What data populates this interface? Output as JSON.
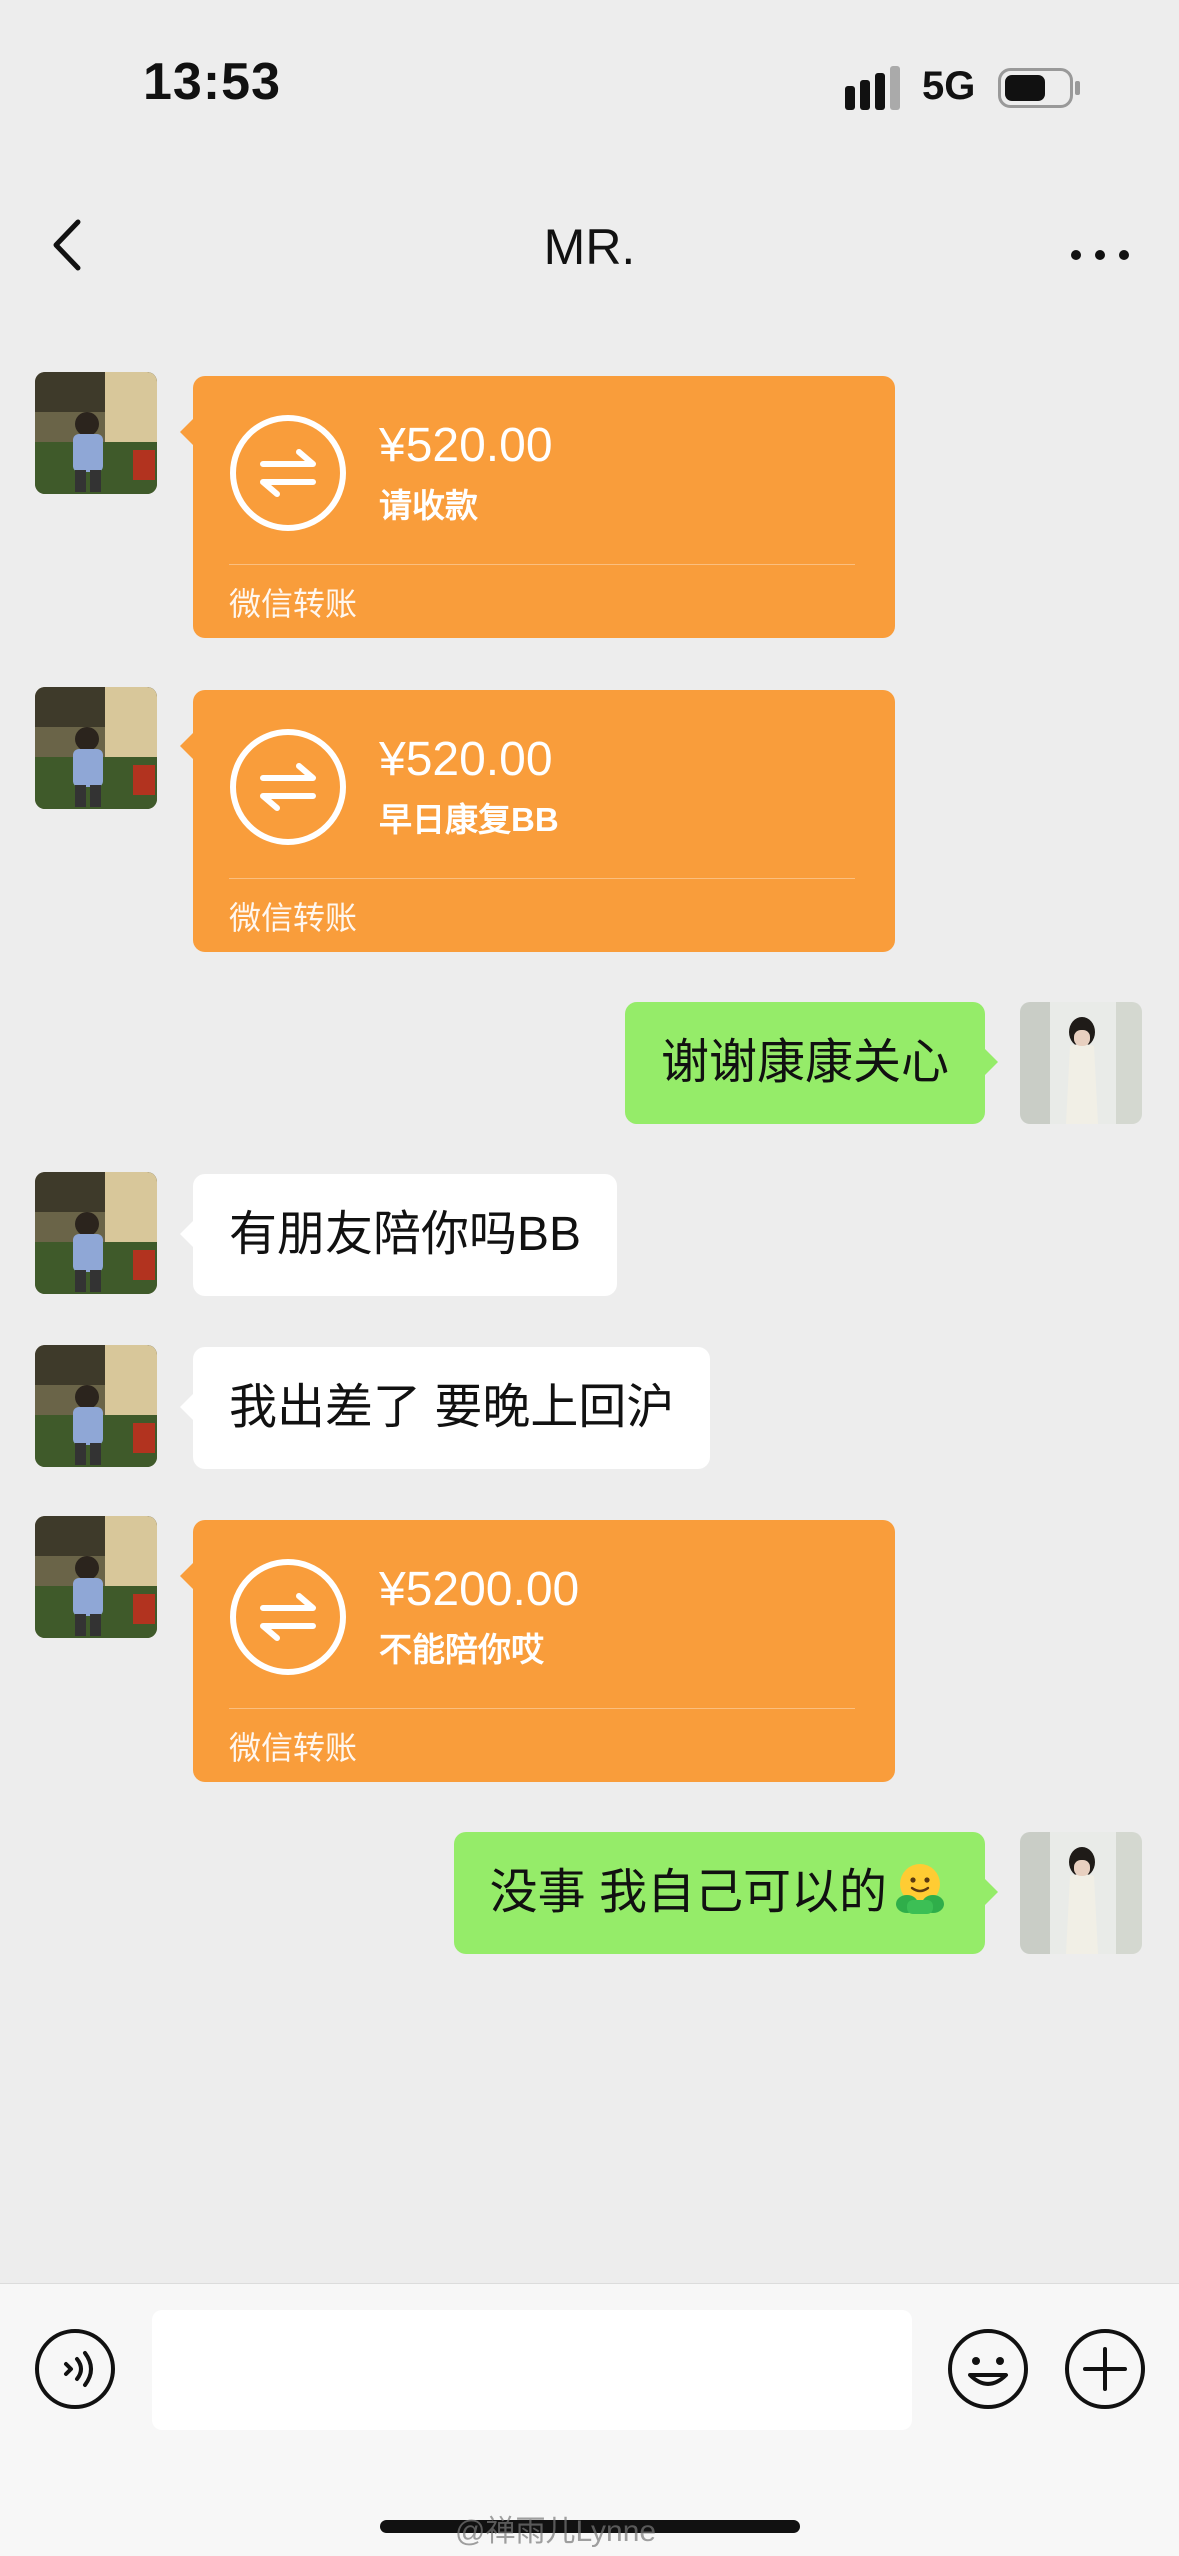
{
  "status_bar": {
    "time": "13:53",
    "network": "5G"
  },
  "header": {
    "title": "MR."
  },
  "messages": [
    {
      "side": "left",
      "type": "transfer",
      "amount": "¥520.00",
      "note": "请收款",
      "footer": "微信转账"
    },
    {
      "side": "left",
      "type": "transfer",
      "amount": "¥520.00",
      "note": "早日康复BB",
      "footer": "微信转账"
    },
    {
      "side": "right",
      "type": "text",
      "text": "谢谢康康关心"
    },
    {
      "side": "left",
      "type": "text",
      "text": "有朋友陪你吗BB"
    },
    {
      "side": "left",
      "type": "text",
      "text": "我出差了 要晚上回沪"
    },
    {
      "side": "left",
      "type": "transfer",
      "amount": "¥5200.00",
      "note": "不能陪你哎",
      "footer": "微信转账"
    },
    {
      "side": "right",
      "type": "text",
      "text": "没事  我自己可以的",
      "emoji": "hugging-face-icon"
    }
  ],
  "input": {
    "placeholder": ""
  },
  "watermark": "@禅雨儿Lynne",
  "colors": {
    "transfer": "#f99d3b",
    "sent_bubble": "#95ec69",
    "received_bubble": "#ffffff",
    "background": "#ededed"
  }
}
